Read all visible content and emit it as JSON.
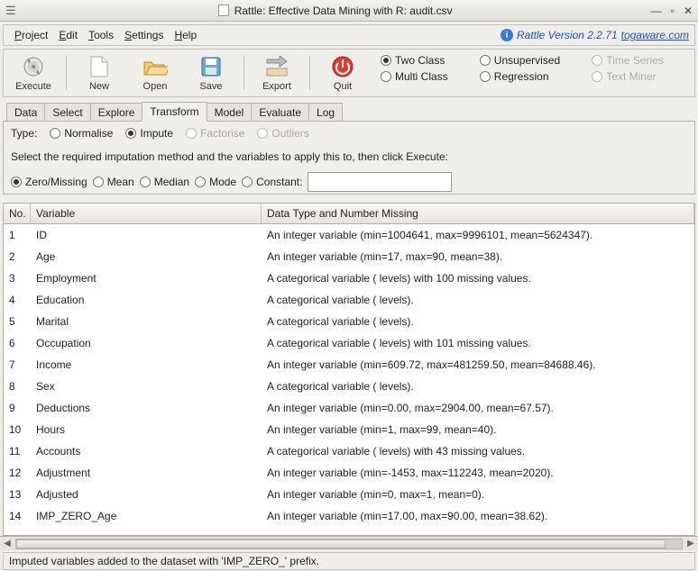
{
  "window": {
    "title": "Rattle: Effective Data Mining with R: audit.csv"
  },
  "menu": {
    "items": [
      {
        "label": "Project",
        "u": 0
      },
      {
        "label": "Edit",
        "u": 0
      },
      {
        "label": "Tools",
        "u": 0
      },
      {
        "label": "Settings",
        "u": 0
      },
      {
        "label": "Help",
        "u": 0
      }
    ],
    "version_prefix": "Rattle Version 2.2.71 ",
    "version_link": "togaware.com"
  },
  "toolbar": {
    "execute": "Execute",
    "new": "New",
    "open": "Open",
    "save": "Save",
    "export": "Export",
    "quit": "Quit",
    "mode_radios_row1": [
      {
        "label": "Two Class",
        "selected": true,
        "disabled": false
      },
      {
        "label": "Unsupervised",
        "selected": false,
        "disabled": false
      },
      {
        "label": "Time Series",
        "selected": false,
        "disabled": true
      }
    ],
    "mode_radios_row2": [
      {
        "label": "Multi Class",
        "selected": false,
        "disabled": false
      },
      {
        "label": "Regression",
        "selected": false,
        "disabled": false
      },
      {
        "label": "Text Miner",
        "selected": false,
        "disabled": true
      }
    ]
  },
  "tabs": [
    "Data",
    "Select",
    "Explore",
    "Transform",
    "Model",
    "Evaluate",
    "Log"
  ],
  "active_tab": "Transform",
  "type_row": {
    "label": "Type:",
    "options": [
      {
        "label": "Normalise",
        "selected": false,
        "disabled": false
      },
      {
        "label": "Impute",
        "selected": true,
        "disabled": false
      },
      {
        "label": "Factorise",
        "selected": false,
        "disabled": true
      },
      {
        "label": "Outliers",
        "selected": false,
        "disabled": true
      }
    ]
  },
  "instruction": "Select the required imputation method and the variables to apply this to, then click Execute:",
  "methods": [
    {
      "label": "Zero/Missing",
      "selected": true
    },
    {
      "label": "Mean",
      "selected": false
    },
    {
      "label": "Median",
      "selected": false
    },
    {
      "label": "Mode",
      "selected": false
    },
    {
      "label": "Constant:",
      "selected": false
    }
  ],
  "constant_value": "",
  "table": {
    "headers": [
      "No.",
      "Variable",
      "Data Type and Number Missing"
    ],
    "rows": [
      {
        "no": "1",
        "var": "ID",
        "desc": "An integer variable (min=1004641, max=9996101, mean=5624347)."
      },
      {
        "no": "2",
        "var": "Age",
        "desc": "An integer variable (min=17, max=90, mean=38)."
      },
      {
        "no": "3",
        "var": "Employment",
        "desc": "A categorical variable ( levels) with 100 missing values."
      },
      {
        "no": "4",
        "var": "Education",
        "desc": "A categorical variable ( levels)."
      },
      {
        "no": "5",
        "var": "Marital",
        "desc": "A categorical variable ( levels)."
      },
      {
        "no": "6",
        "var": "Occupation",
        "desc": "A categorical variable ( levels) with 101 missing values."
      },
      {
        "no": "7",
        "var": "Income",
        "desc": "An integer variable (min=609.72, max=481259.50, mean=84688.46)."
      },
      {
        "no": "8",
        "var": "Sex",
        "desc": "A categorical variable ( levels)."
      },
      {
        "no": "9",
        "var": "Deductions",
        "desc": "An integer variable (min=0.00, max=2904.00, mean=67.57)."
      },
      {
        "no": "10",
        "var": "Hours",
        "desc": "An integer variable (min=1, max=99, mean=40)."
      },
      {
        "no": "11",
        "var": "Accounts",
        "desc": "A categorical variable ( levels) with 43 missing values."
      },
      {
        "no": "12",
        "var": "Adjustment",
        "desc": "An integer variable (min=-1453, max=112243, mean=2020)."
      },
      {
        "no": "13",
        "var": "Adjusted",
        "desc": "An integer variable (min=0, max=1, mean=0)."
      },
      {
        "no": "14",
        "var": "IMP_ZERO_Age",
        "desc": "An integer variable (min=17.00, max=90.00, mean=38.62)."
      }
    ]
  },
  "status": "Imputed variables added to the dataset with 'IMP_ZERO_' prefix."
}
